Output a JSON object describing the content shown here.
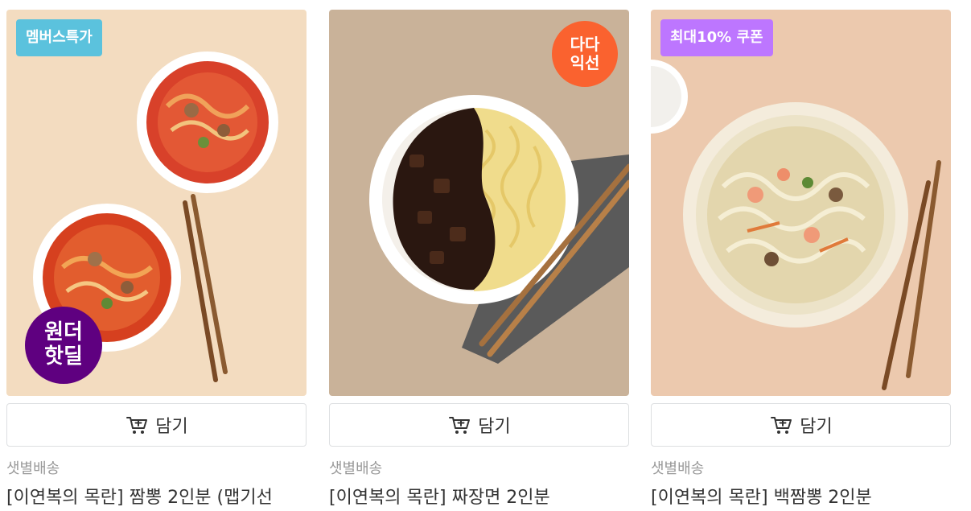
{
  "products": [
    {
      "tag": "멤버스특가",
      "badge_line1": "원더",
      "badge_line2": "핫딜",
      "cart_label": "담기",
      "delivery": "샛별배송",
      "name": "[이연복의 목란] 짬뽕 2인분 (맵기선"
    },
    {
      "badge_line1": "다다",
      "badge_line2": "익선",
      "cart_label": "담기",
      "delivery": "샛별배송",
      "name": "[이연복의 목란] 짜장면 2인분"
    },
    {
      "tag": "최대10% 쿠폰",
      "cart_label": "담기",
      "delivery": "샛별배송",
      "name": "[이연복의 목란] 백짬뽕 2인분"
    }
  ],
  "colors": {
    "tag_members": "#5bc2dd",
    "tag_coupon": "#bd76ff",
    "badge_wonder": "#5f0080",
    "badge_dada": "#fa622f"
  },
  "icons": [
    "cart-icon"
  ]
}
